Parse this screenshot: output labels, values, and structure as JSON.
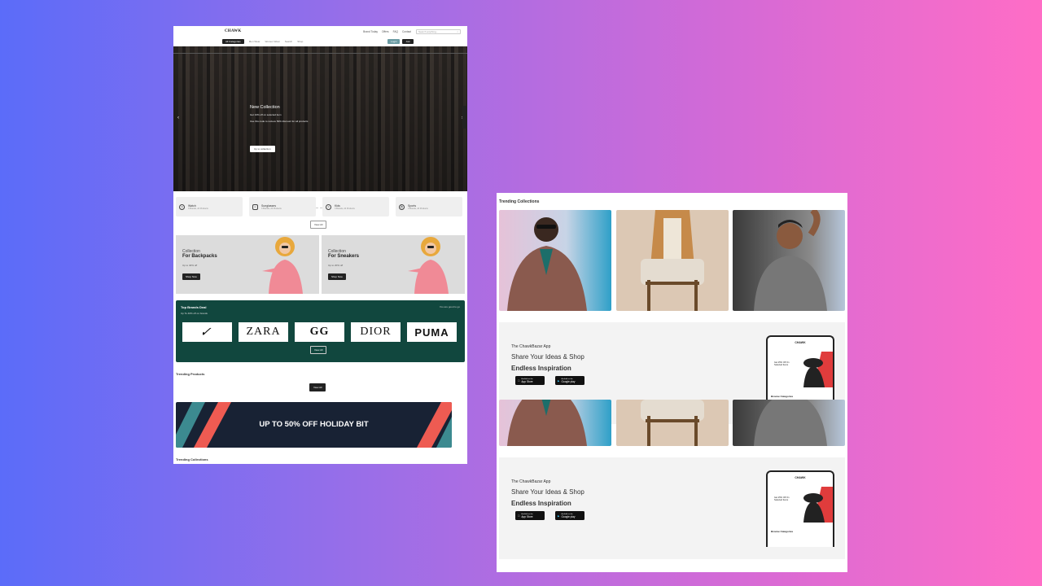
{
  "left": {
    "logo": "CHAWK",
    "nav": [
      "Brand Today",
      "Offers",
      "FAQ",
      "Contact"
    ],
    "search_placeholder": "Search anything...",
    "all_categories": "All Categories",
    "subnav": [
      "Men Wear",
      "Women Wear",
      "Search",
      "Shop"
    ],
    "login": "Login",
    "join": "Join",
    "hero": {
      "title": "New Collection",
      "line1": "Get 10% off on selected item",
      "line2": "Use this code to recieve 50% discount for all products",
      "cta": "Up to collection"
    },
    "categories": [
      {
        "name": "Watch",
        "sub": "3 Brands, 24 Products"
      },
      {
        "name": "Sunglasses",
        "sub": "3 Brands, 24 Products"
      },
      {
        "name": "Kids",
        "sub": "3 Brands, 24 Products"
      },
      {
        "name": "Sports",
        "sub": "3 Brands, 24 Products"
      }
    ],
    "view_all": "View All",
    "promos": [
      {
        "t1": "Collection",
        "t2": "For Backpacks",
        "t3": "Up to 40% off",
        "btn": "Shop Now"
      },
      {
        "t1": "Collection",
        "t2": "For Sneakers",
        "t3": "Up to 20% off",
        "btn": "Shop Now"
      }
    ],
    "brands": {
      "title": "Top Brands Deal",
      "sub": "Up To 40% off on brands",
      "right": "You are good to go",
      "logos": [
        "✓",
        "ZARA",
        "GG",
        "DIOR",
        "PUMA"
      ],
      "view_all": "View All"
    },
    "trending_products": "Trending Products",
    "trending_view_all": "View All",
    "banner_text": "UP TO 50% OFF HOLIDAY BIT",
    "trending_collections": "Trending Collections"
  },
  "right": {
    "title": "Trending Collections",
    "app_label": "The ChawkBazar App",
    "app_h1": "Share Your Ideas & Shop",
    "app_h2": "Endless Inspiration",
    "app_store": "App Store",
    "google_play": "Google play",
    "app_store_small": "Available on the",
    "google_play_small": "Available on the",
    "phone_title": "CHAWK",
    "browse": "Browse Categories",
    "phone_offer": "Get 25% Off On Selected Items"
  }
}
